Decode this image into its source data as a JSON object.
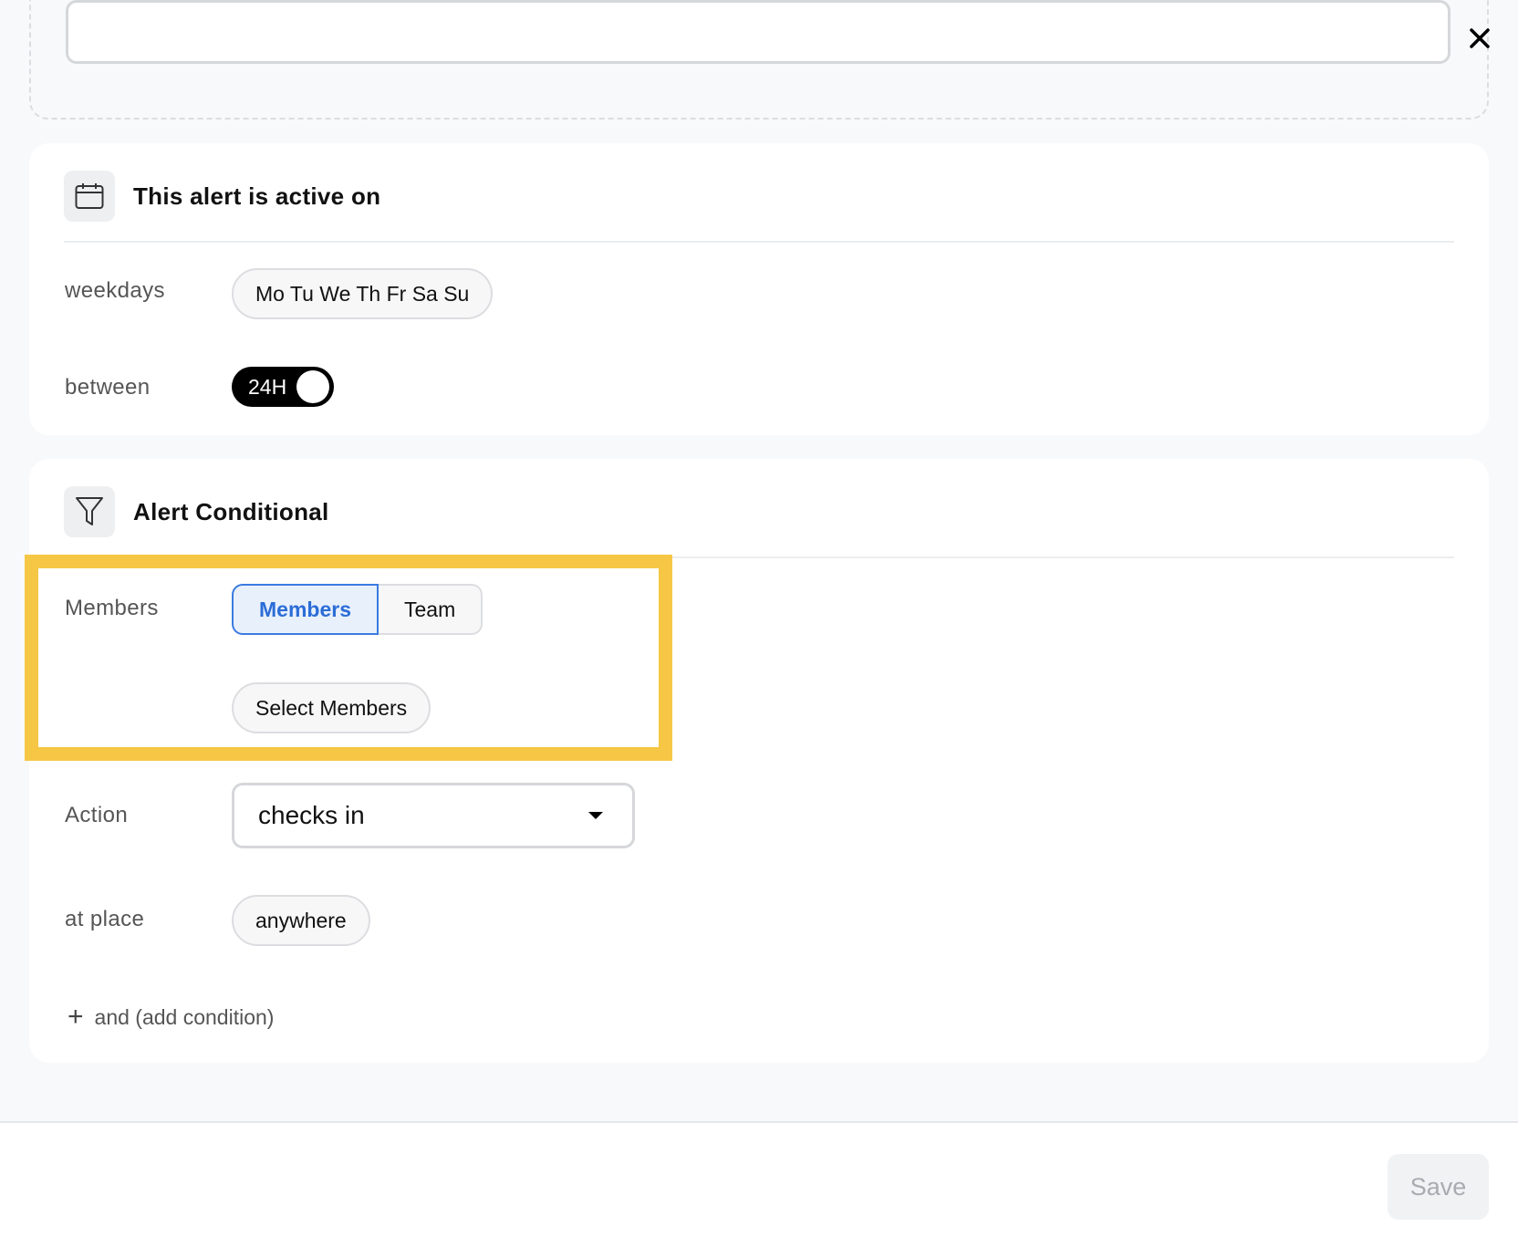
{
  "top_input": {
    "value": "",
    "placeholder": ""
  },
  "active_card": {
    "title": "This alert is active on",
    "weekdays_label": "weekdays",
    "weekdays_value": "Mo Tu We Th Fr Sa Su",
    "between_label": "between",
    "toggle_label": "24H",
    "toggle_on": true
  },
  "condition_card": {
    "title": "Alert Conditional",
    "members_label": "Members",
    "segment": {
      "options": [
        "Members",
        "Team"
      ],
      "selected": "Members"
    },
    "select_members_label": "Select Members",
    "action_label": "Action",
    "action_value": "checks in",
    "place_label": "at place",
    "place_value": "anywhere",
    "add_condition_label": "and (add condition)"
  },
  "footer": {
    "save_label": "Save"
  },
  "colors": {
    "highlight": "#f6c745",
    "accent": "#2b6dd6",
    "toggle_bg": "#000000"
  }
}
